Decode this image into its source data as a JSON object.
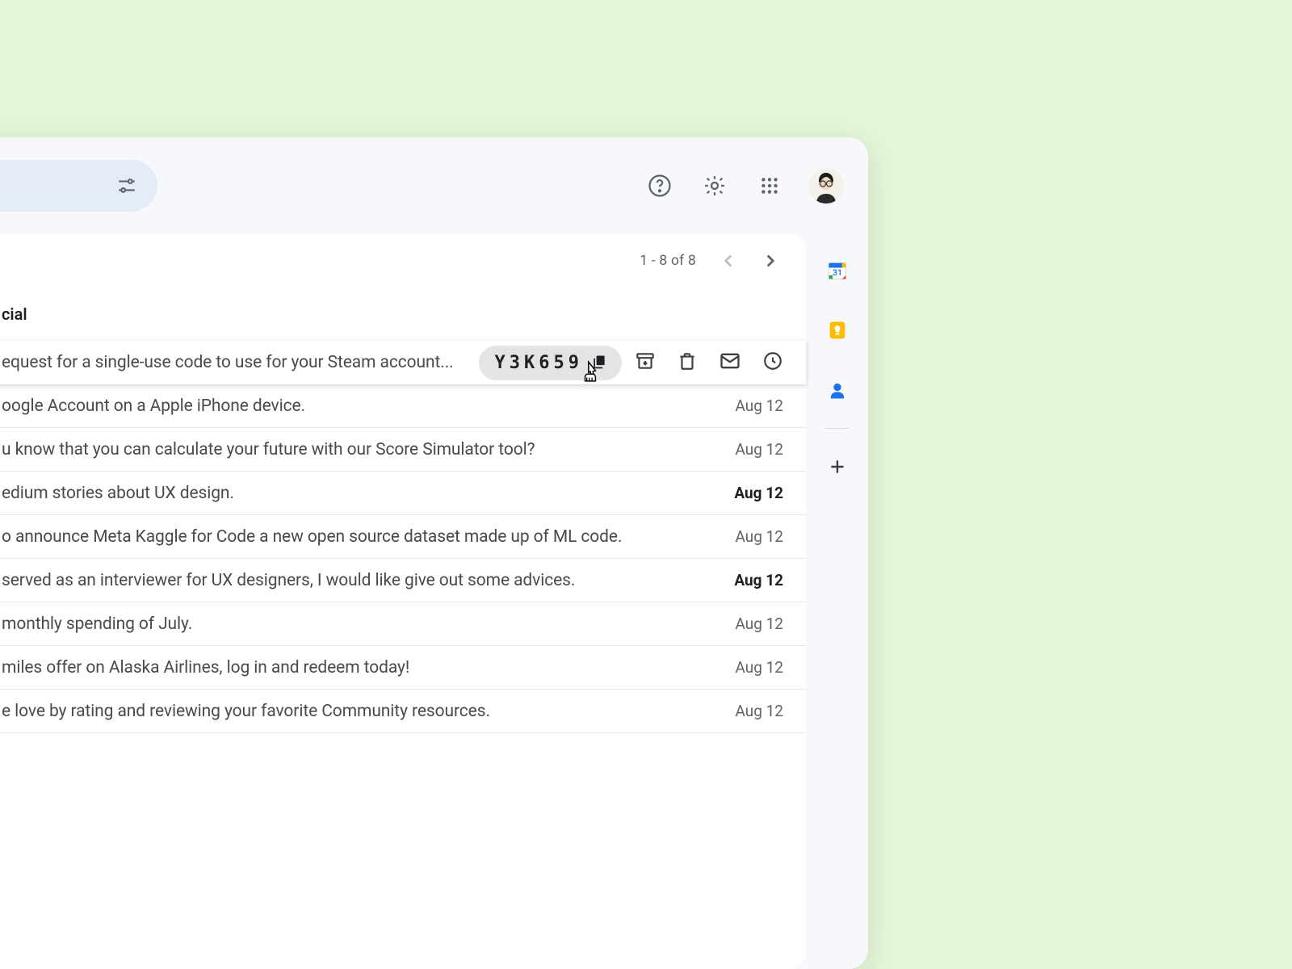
{
  "tab_label": "cial",
  "pagination": "1 - 8 of 8",
  "code_value": "Y3K659",
  "rows": [
    {
      "snippet": "equest for a single-use code to use for your Steam account...",
      "date": "",
      "bold": false,
      "hovered": true
    },
    {
      "snippet": "oogle Account on a Apple iPhone device.",
      "date": "Aug 12",
      "bold": false,
      "hovered": false
    },
    {
      "snippet": "u know that you can calculate your future with our Score Simulator tool?",
      "date": "Aug 12",
      "bold": false,
      "hovered": false
    },
    {
      "snippet": "edium stories about UX design.",
      "date": "Aug 12",
      "bold": true,
      "hovered": false
    },
    {
      "snippet": "o announce Meta Kaggle for Code a new open source dataset made up of ML code.",
      "date": "Aug 12",
      "bold": false,
      "hovered": false
    },
    {
      "snippet": " served as an interviewer for UX designers, I would like give out some advices.",
      "date": "Aug 12",
      "bold": true,
      "hovered": false
    },
    {
      "snippet": "monthly spending of July.",
      "date": "Aug 12",
      "bold": false,
      "hovered": false
    },
    {
      "snippet": "miles offer on Alaska Airlines, log in and redeem today!",
      "date": "Aug 12",
      "bold": false,
      "hovered": false
    },
    {
      "snippet": "e love by rating and reviewing your favorite Community resources.",
      "date": "Aug 12",
      "bold": false,
      "hovered": false
    }
  ]
}
